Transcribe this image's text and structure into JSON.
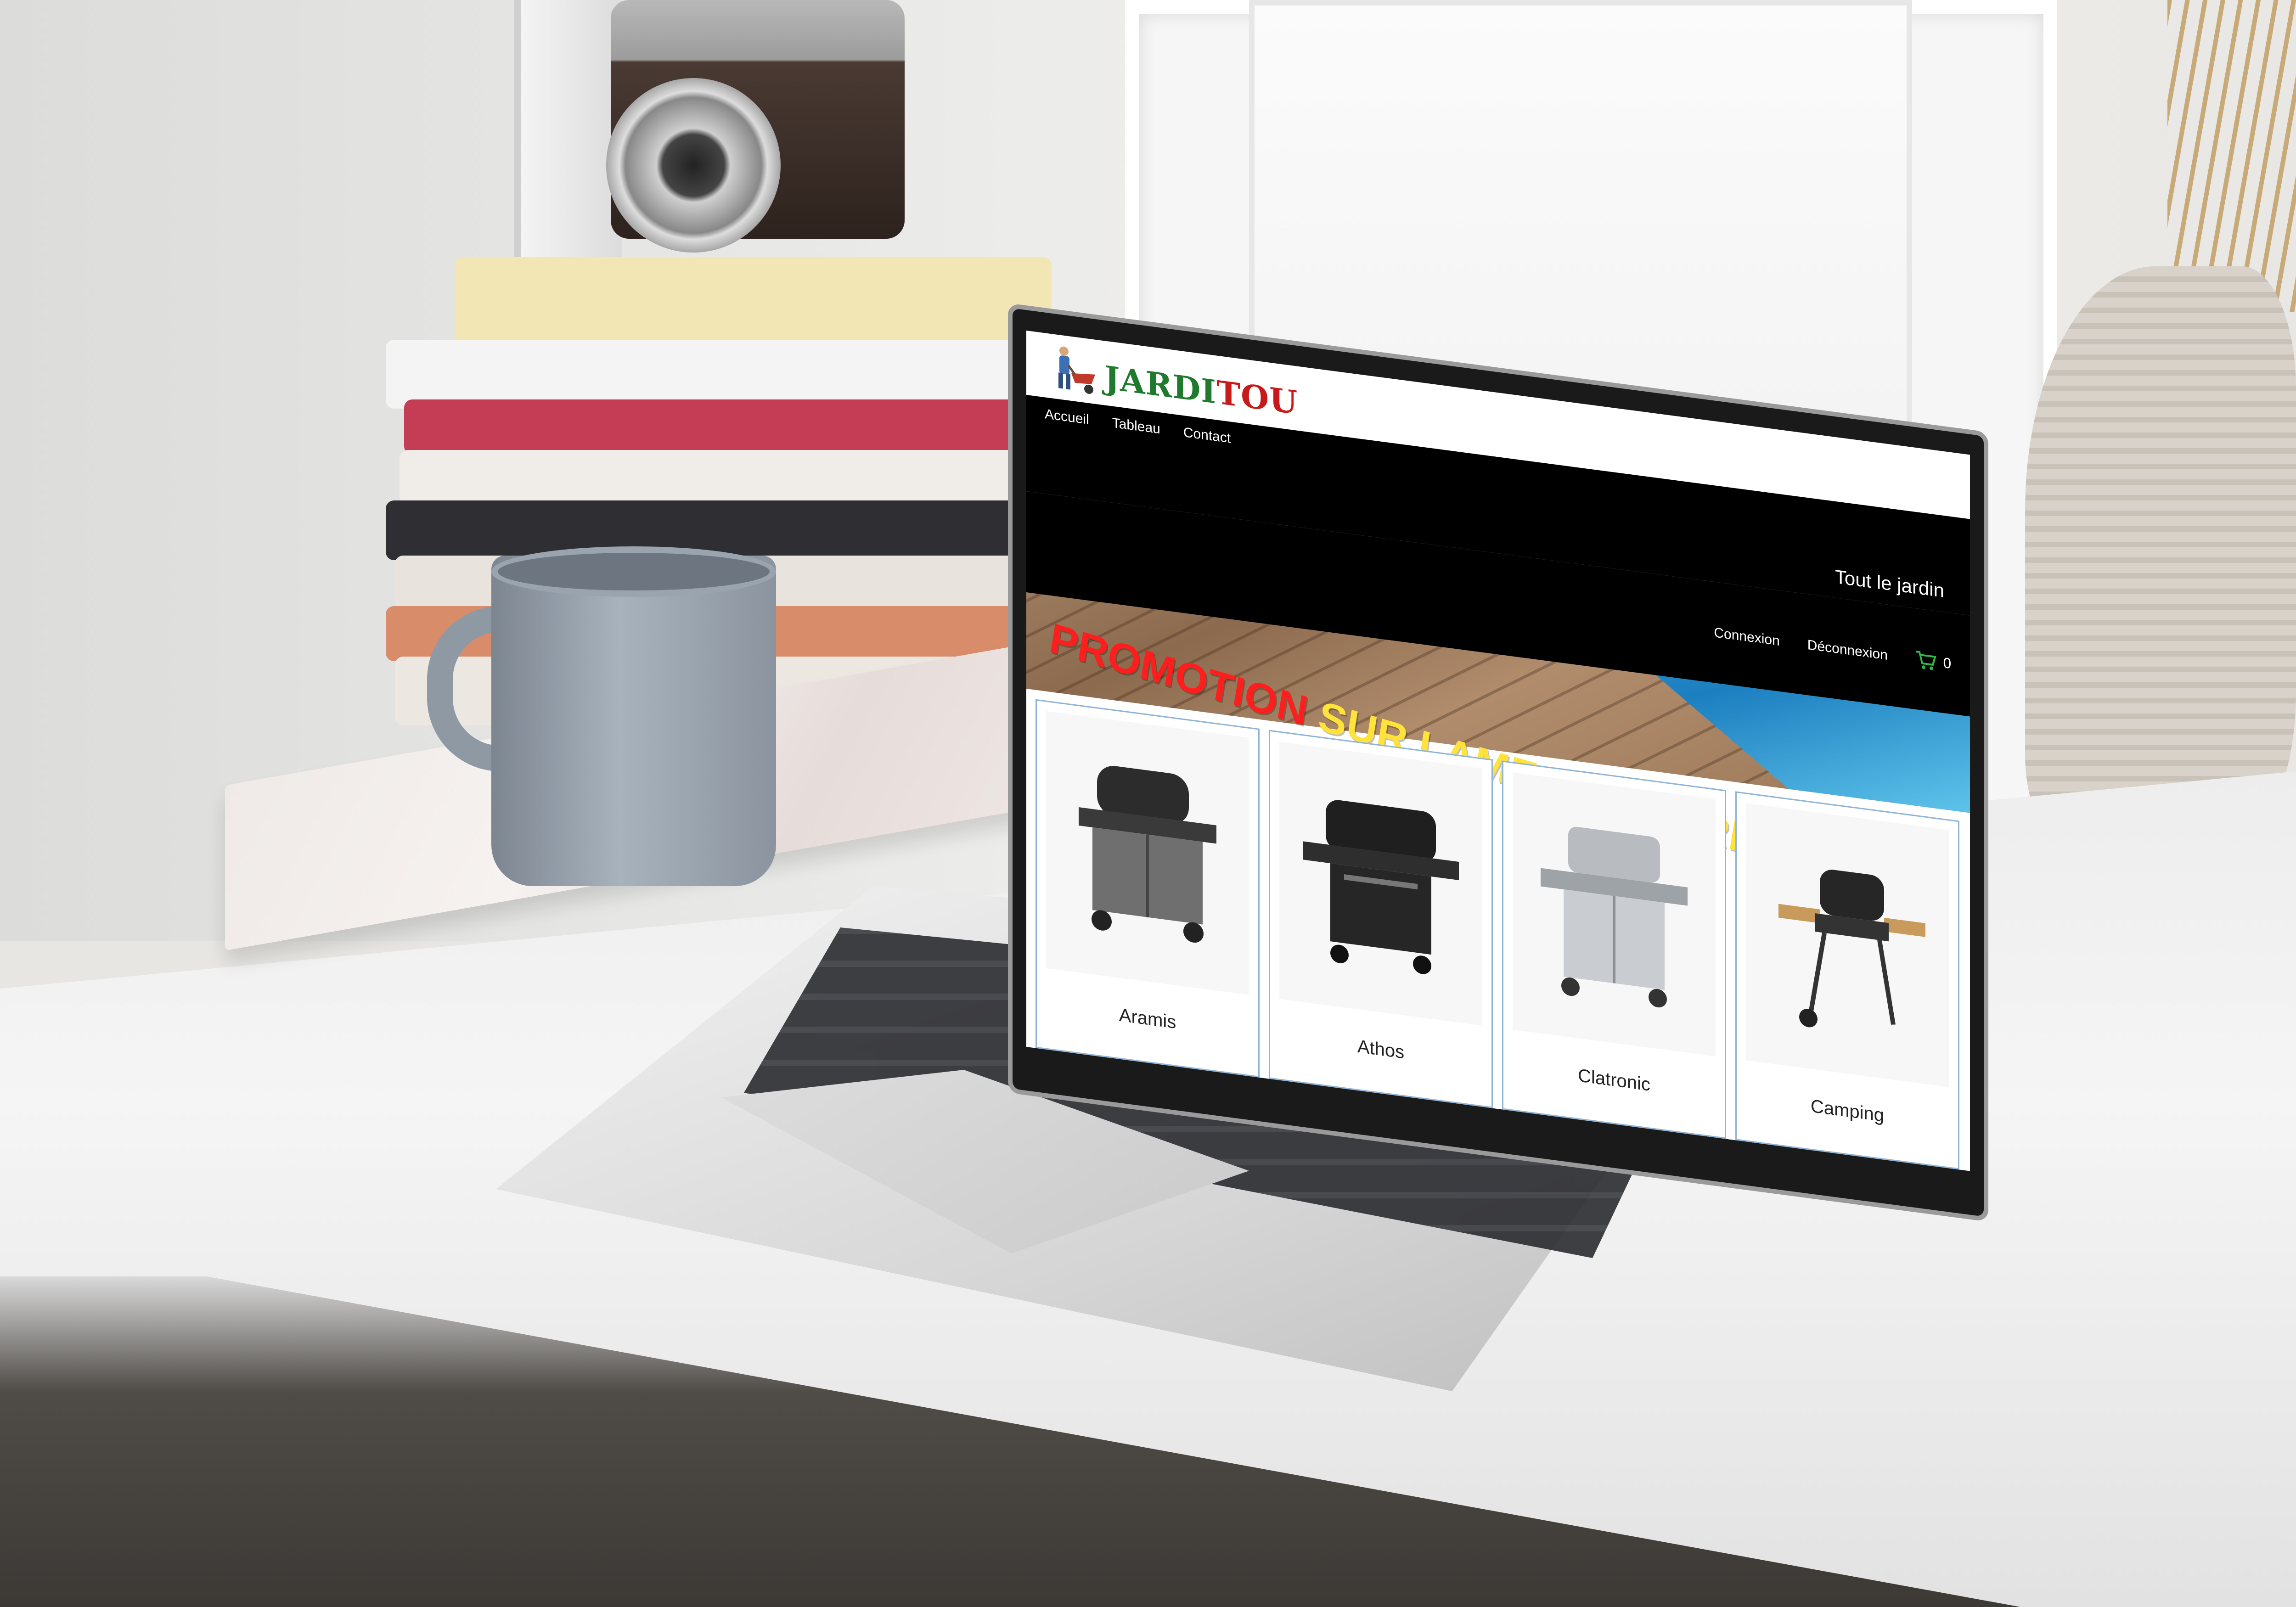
{
  "site": {
    "logo_part1": "JARDI",
    "logo_part2": "TOU",
    "tagline": "Tout le jardin"
  },
  "nav": {
    "items": [
      {
        "label": "Accueil"
      },
      {
        "label": "Tableau"
      },
      {
        "label": "Contact"
      }
    ]
  },
  "user": {
    "login_label": "Connexion",
    "logout_label": "Déconnexion",
    "cart_count": "0"
  },
  "hero": {
    "promo_part1": "PROMOTION",
    "promo_part2": "SUR LAMES DE TERRASSE"
  },
  "products": [
    {
      "name": "Aramis"
    },
    {
      "name": "Athos"
    },
    {
      "name": "Clatronic"
    },
    {
      "name": "Camping"
    }
  ],
  "colors": {
    "logo_green": "#1f7a2e",
    "logo_red": "#c71a1a",
    "promo_red": "#ff1e1e",
    "promo_yellow": "#ffe23a",
    "cart_green": "#2fb84a",
    "nav_background": "#000000",
    "card_border": "#8fb4d6"
  },
  "icons": {
    "cart": "shopping-cart-icon",
    "logo": "gardener-wheelbarrow-icon"
  }
}
